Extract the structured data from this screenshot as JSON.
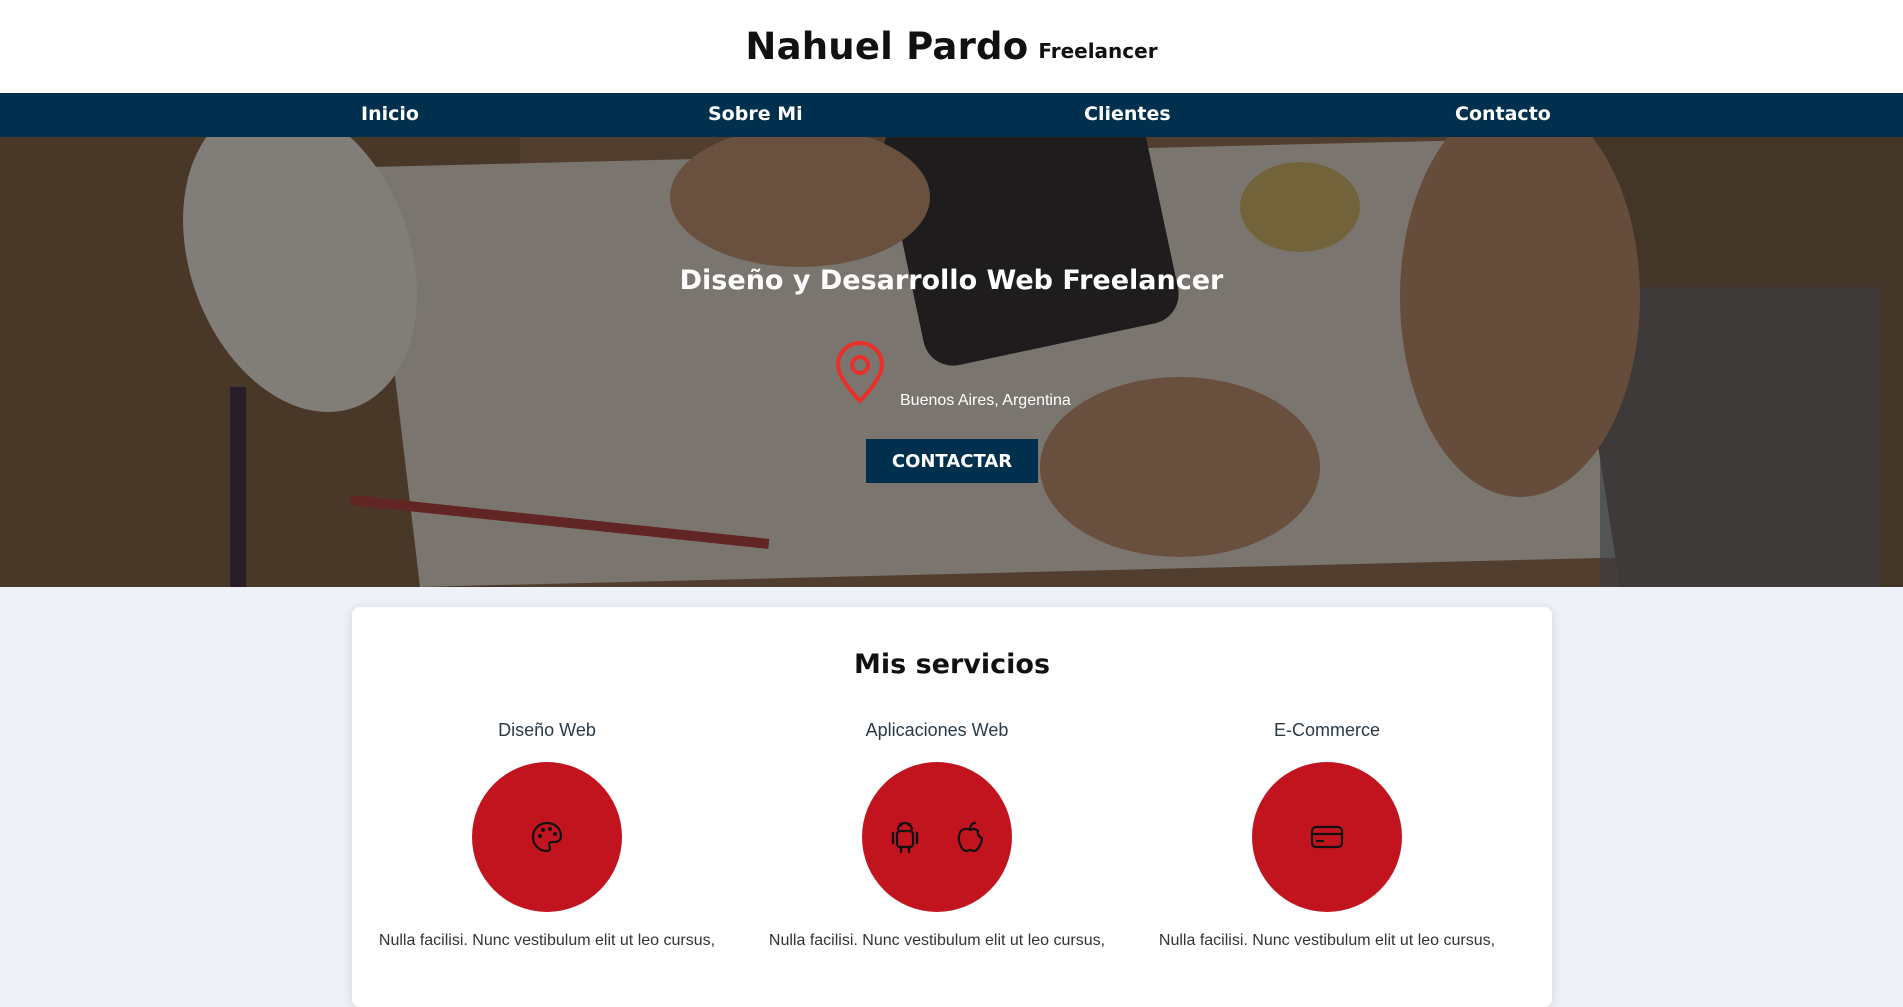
{
  "header": {
    "name": "Nahuel Pardo",
    "tagline": "Freelancer"
  },
  "nav": {
    "items": [
      {
        "label": "Inicio"
      },
      {
        "label": "Sobre Mi"
      },
      {
        "label": "Clientes"
      },
      {
        "label": "Contacto"
      }
    ],
    "background": "#00304d"
  },
  "hero": {
    "title": "Diseño y Desarrollo Web Freelancer",
    "location_icon": "map-pin-icon",
    "location": "Buenos Aires, Argentina",
    "cta_label": "CONTACTAR",
    "accent": "#e8302a"
  },
  "services": {
    "title": "Mis servicios",
    "items": [
      {
        "name": "Diseño Web",
        "icons": [
          "palette-icon"
        ],
        "text": "Nulla facilisi. Nunc vestibulum elit ut leo cursus,"
      },
      {
        "name": "Aplicaciones Web",
        "icons": [
          "android-icon",
          "apple-icon"
        ],
        "text": "Nulla facilisi. Nunc vestibulum elit ut leo cursus,"
      },
      {
        "name": "E-Commerce",
        "icons": [
          "credit-card-icon"
        ],
        "text": "Nulla facilisi. Nunc vestibulum elit ut leo cursus,"
      }
    ],
    "circle_color": "#c2141f"
  }
}
